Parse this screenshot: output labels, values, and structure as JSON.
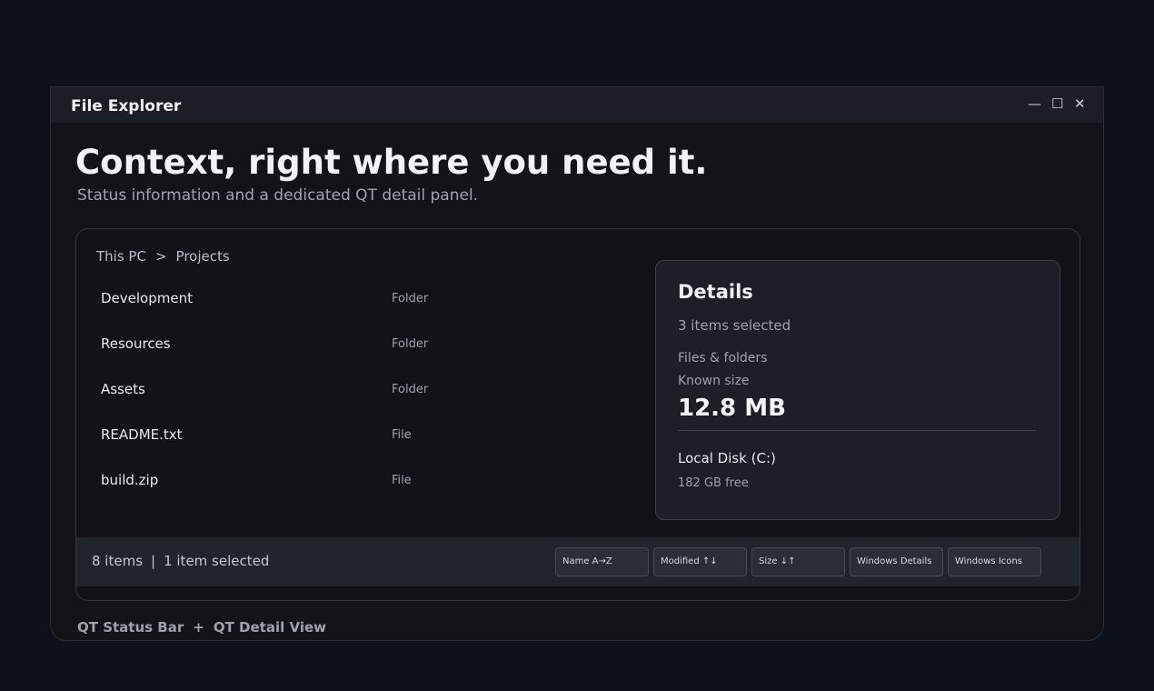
{
  "window": {
    "title": "File Explorer",
    "controls": {
      "minimize": "—",
      "maximize": "☐",
      "close": "✕"
    }
  },
  "hero": {
    "headline": "Context, right where you need it.",
    "subheadline": "Status information and a dedicated QT detail panel."
  },
  "breadcrumb": {
    "root": "This PC",
    "separator": ">",
    "current": "Projects"
  },
  "files": [
    {
      "name": "Development",
      "type": "Folder"
    },
    {
      "name": "Resources",
      "type": "Folder"
    },
    {
      "name": "Assets",
      "type": "Folder"
    },
    {
      "name": "README.txt",
      "type": "File"
    },
    {
      "name": "build.zip",
      "type": "File"
    }
  ],
  "details": {
    "title": "Details",
    "selection": "3 items selected",
    "label_files": "Files & folders",
    "label_size": "Known size",
    "size": "12.8 MB",
    "disk": "Local Disk (C:)",
    "free": "182 GB free"
  },
  "status": {
    "items": "8 items",
    "separator": "|",
    "selected": "1 item selected",
    "buttons": [
      "Name A→Z",
      "Modified ↑↓",
      "Size ↓↑",
      "Windows Details",
      "Windows Icons"
    ]
  },
  "footer": {
    "left": "QT Status Bar",
    "plus": "+",
    "right": "QT Detail View"
  }
}
